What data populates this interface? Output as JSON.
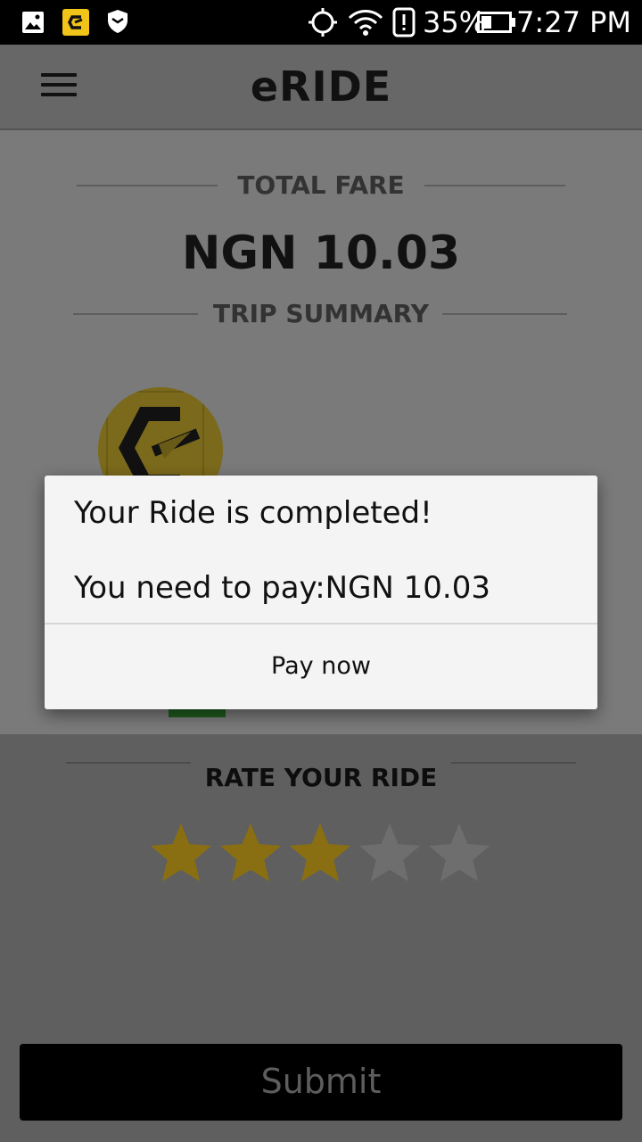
{
  "status_bar": {
    "battery_percent": "35%",
    "time": "7:27 PM",
    "icons": [
      "image-icon",
      "app-logo-icon",
      "shield-icon",
      "location-icon",
      "wifi-icon",
      "alert-icon",
      "battery-icon"
    ]
  },
  "app_bar": {
    "title": "eRIDE",
    "menu_icon": "hamburger-icon"
  },
  "fare": {
    "label": "TOTAL FARE",
    "amount": "NGN 10.03"
  },
  "trip_summary": {
    "label": "TRIP SUMMARY"
  },
  "rating": {
    "label": "RATE YOUR RIDE",
    "value": 3,
    "max": 5,
    "filled_color": "#8a6f12",
    "empty_color": "#6e6e6e"
  },
  "submit": {
    "label": "Submit"
  },
  "dialog": {
    "title": "Your Ride is completed!",
    "message": "You need to pay:NGN 10.03",
    "button_label": "Pay now"
  },
  "colors": {
    "accent": "#f5c518",
    "scrim": "#5f5f5f"
  }
}
